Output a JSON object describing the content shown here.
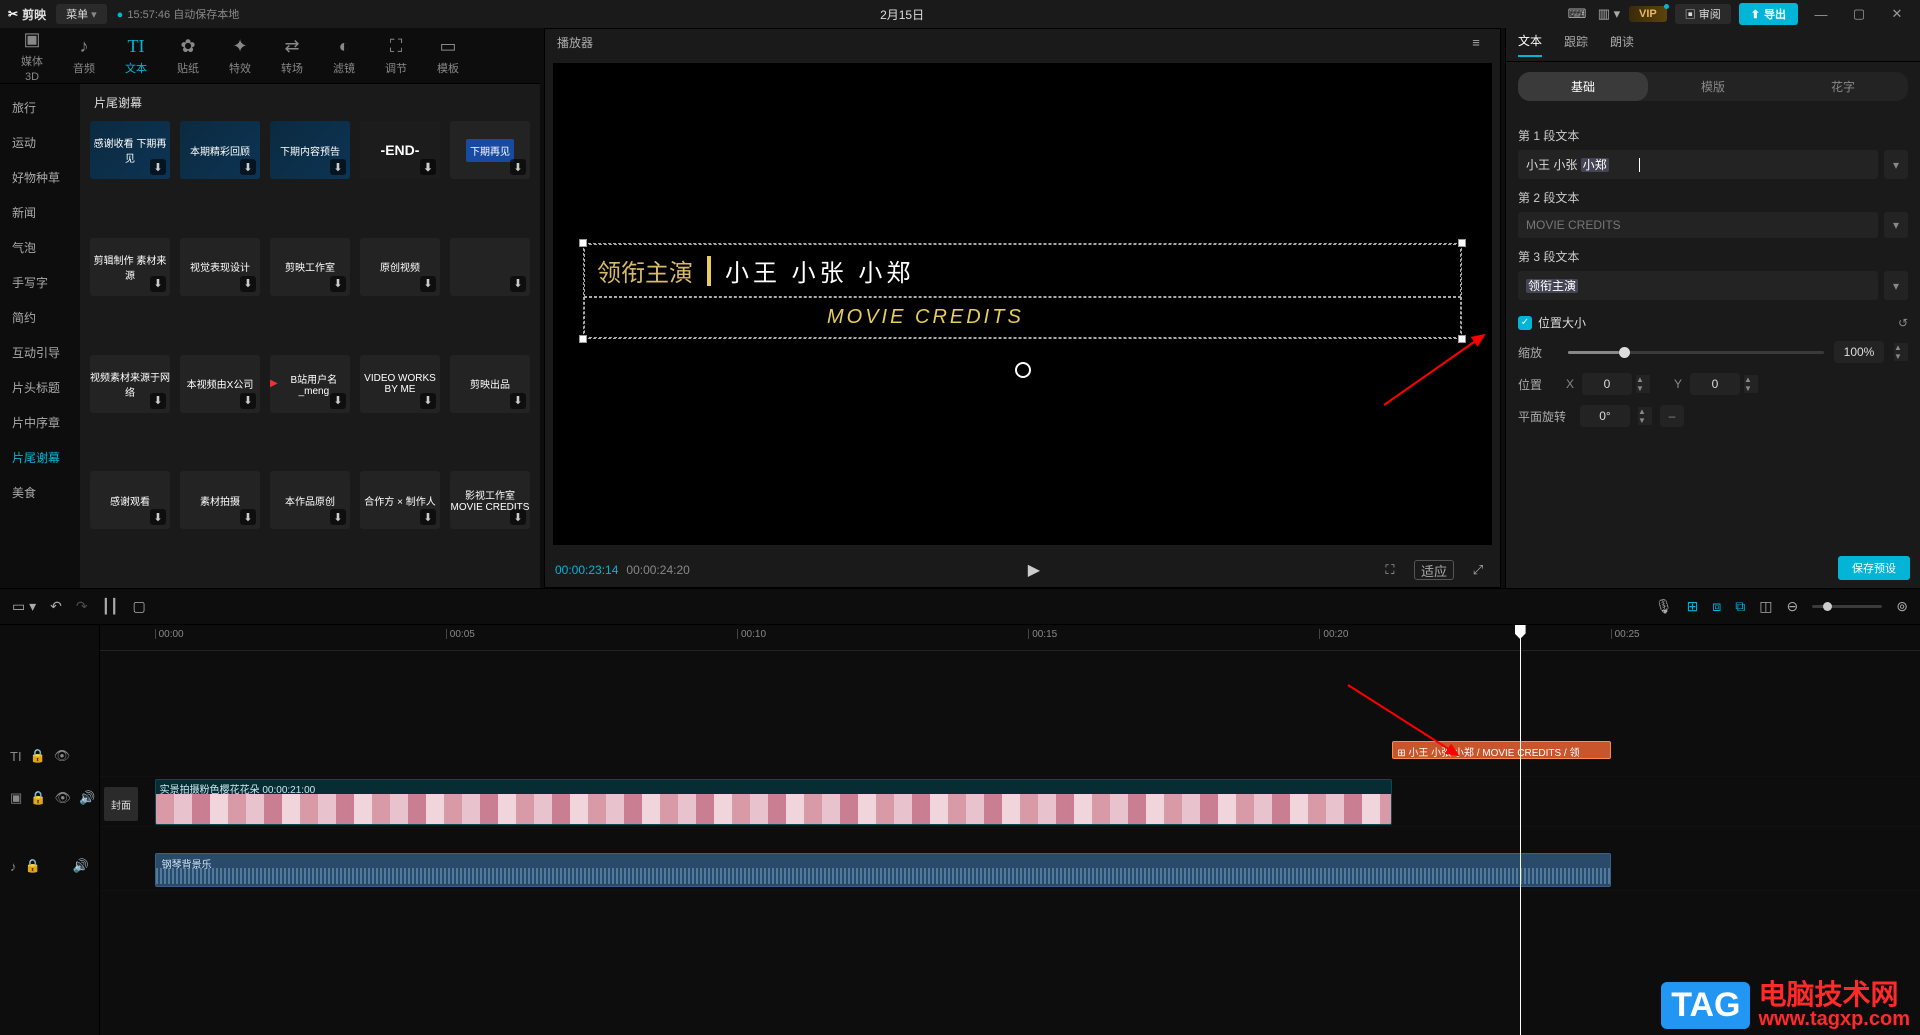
{
  "titlebar": {
    "app_name": "剪映",
    "menu": "菜单",
    "autosave_time": "15:57:46",
    "autosave_text": "自动保存本地",
    "project_title": "2月15日",
    "vip": "VIP",
    "review": "审阅",
    "export": "导出"
  },
  "topTabs": [
    {
      "icon": "▣",
      "label": "媒体",
      "sub": "3D"
    },
    {
      "icon": "♪",
      "label": "音频"
    },
    {
      "icon": "TI",
      "label": "文本",
      "active": true
    },
    {
      "icon": "✿",
      "label": "贴纸"
    },
    {
      "icon": "✦",
      "label": "特效"
    },
    {
      "icon": "⇄",
      "label": "转场"
    },
    {
      "icon": "◐",
      "label": "滤镜"
    },
    {
      "icon": "⛶",
      "label": "调节"
    },
    {
      "icon": "▭",
      "label": "模板"
    }
  ],
  "sideCats": [
    "旅行",
    "运动",
    "好物种草",
    "新闻",
    "气泡",
    "手写字",
    "简约",
    "互动引导",
    "片头标题",
    "片中序章",
    "片尾谢幕",
    "美食"
  ],
  "sideActive": "片尾谢幕",
  "templateSectionTitle": "片尾谢幕",
  "templates": [
    "感谢收看 下期再见",
    "本期精彩回顾",
    "下期内容预告",
    "-END-",
    "下期再见",
    "剪辑制作 素材来源",
    "视觉表现设计",
    "剪映工作室",
    "原创视频",
    "",
    "视频素材来源于网络",
    "本视频由X公司",
    "B站用户名_meng",
    "VIDEO WORKS BY ME",
    "剪映出品",
    "感谢观看",
    "素材拍摄",
    "本作品原创",
    "合作方 × 制作人",
    "影视工作室 MOVIE CREDITS"
  ],
  "player": {
    "label": "播放器",
    "leader": "领衔主演",
    "names": "小王  小张  小郑",
    "subtitle": "MOVIE CREDITS",
    "cur": "00:00:23:14",
    "dur": "00:00:24:20",
    "ratio": "适应"
  },
  "inspector": {
    "tabs": [
      "文本",
      "跟踪",
      "朗读"
    ],
    "segTabs": [
      "基础",
      "模版",
      "花字"
    ],
    "seg1_label": "第 1 段文本",
    "seg1_prefix": "小王 小张 ",
    "seg1_sel": "小郑",
    "seg2_label": "第 2 段文本",
    "seg2_value": "MOVIE CREDITS",
    "seg3_label": "第 3 段文本",
    "seg3_value": "领衔主演",
    "pos_size": "位置大小",
    "scale": "缩放",
    "scale_val": "100%",
    "pos": "位置",
    "x": "0",
    "y": "0",
    "rotate": "平面旋转",
    "rot_val": "0°",
    "save": "保存预设"
  },
  "timeline": {
    "ruler": [
      "00:00",
      "00:05",
      "00:10",
      "00:15",
      "00:20",
      "00:25"
    ],
    "playhead_pct": 81.2,
    "text_clip": "小王  小张  小郑 / MOVIE CREDITS / 领",
    "video_clip": "实景拍摄粉色樱花花朵  00:00:21:00",
    "cover": "封面",
    "audio_clip": "钢琴背景乐"
  },
  "watermark": {
    "tag": "TAG",
    "title": "电脑技术网",
    "url": "www.tagxp.com"
  }
}
